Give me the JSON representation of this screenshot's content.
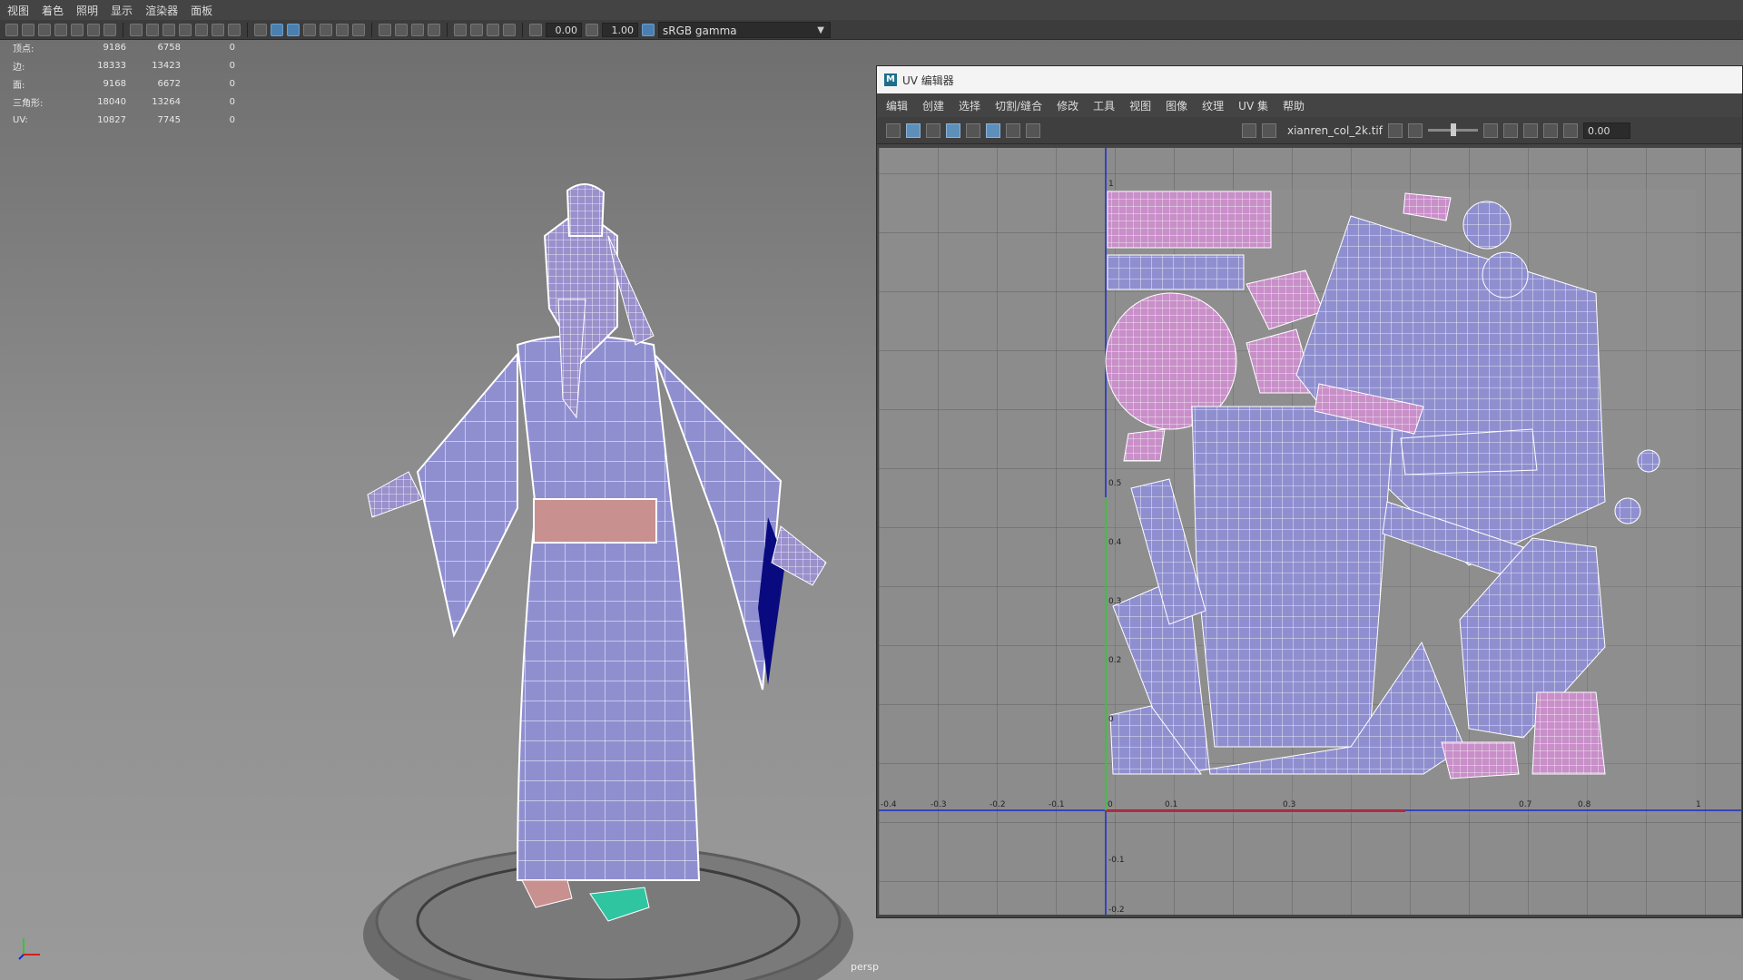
{
  "menubar": {
    "items": [
      "视图",
      "着色",
      "照明",
      "显示",
      "渲染器",
      "面板"
    ]
  },
  "toolbar": {
    "exposure": "0.00",
    "gamma": "1.00",
    "color_space": "sRGB gamma"
  },
  "hud": {
    "rows": [
      {
        "label": "顶点:",
        "a": "9186",
        "b": "6758",
        "c": "0"
      },
      {
        "label": "边:",
        "a": "18333",
        "b": "13423",
        "c": "0"
      },
      {
        "label": "面:",
        "a": "9168",
        "b": "6672",
        "c": "0"
      },
      {
        "label": "三角形:",
        "a": "18040",
        "b": "13264",
        "c": "0"
      },
      {
        "label": "UV:",
        "a": "10827",
        "b": "7745",
        "c": "0"
      }
    ]
  },
  "viewport": {
    "camera_label": "persp"
  },
  "uv_editor": {
    "title": "UV 编辑器",
    "logo": "M",
    "menu": [
      "编辑",
      "创建",
      "选择",
      "切割/缝合",
      "修改",
      "工具",
      "视图",
      "图像",
      "纹理",
      "UV 集",
      "帮助"
    ],
    "texture_name": "xianren_col_2k.tif",
    "value": "0.00",
    "axis_labels_x": [
      "-0.4",
      "-0.3",
      "-0.2",
      "-0.1",
      "0",
      "0.1",
      "0.3",
      "0.7",
      "0.8",
      "1"
    ],
    "axis_labels_y": [
      "1",
      "0.5",
      "0.4",
      "0.3",
      "0.2",
      "0",
      "-0.1",
      "-0.2"
    ]
  },
  "colors": {
    "mesh_fill": "#8f8fd0",
    "mesh_pink": "#c98fc9",
    "wire": "#ffffff",
    "grid_line": "#5a5a5a",
    "axis_blue": "#1a2cc8",
    "axis_green": "#39c43a",
    "axis_red": "#d42020",
    "sleeve_inner": "#0a0a80"
  }
}
